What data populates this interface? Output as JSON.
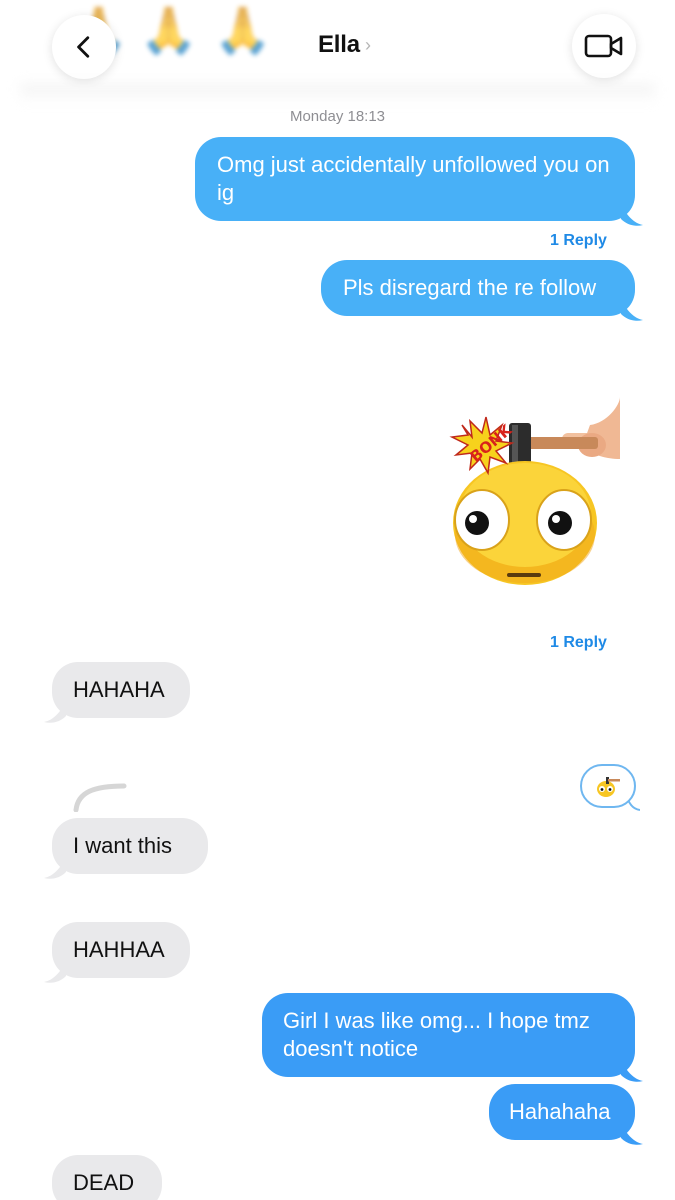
{
  "header": {
    "contact_name": "Ella",
    "name_chevron": "›",
    "blurred_emojis": [
      "🙏",
      "🙏",
      "🙏"
    ]
  },
  "thread": {
    "timestamp": "Monday 18:13",
    "messages": [
      {
        "id": "m1",
        "direction": "outgoing",
        "text": "Omg just accidentally unfollowed you on ig"
      },
      {
        "id": "m1_reply",
        "text": "1 Reply"
      },
      {
        "id": "m2",
        "direction": "outgoing",
        "text": "Pls disregard the re follow"
      },
      {
        "id": "m3",
        "direction": "outgoing",
        "type": "sticker",
        "sticker": "bonk-emoji-sticker"
      },
      {
        "id": "m3_reply",
        "text": "1 Reply"
      },
      {
        "id": "m4",
        "direction": "incoming",
        "text": "HAHAHA"
      },
      {
        "id": "m5",
        "direction": "incoming",
        "text": "I want this"
      },
      {
        "id": "m6",
        "direction": "incoming",
        "text": "HAHHAA"
      },
      {
        "id": "m7",
        "direction": "outgoing",
        "text": "Girl I was like omg... I hope tmz doesn't notice"
      },
      {
        "id": "m8",
        "direction": "outgoing",
        "text": "Hahahaha"
      },
      {
        "id": "m9",
        "direction": "incoming",
        "text": "DEAD"
      }
    ],
    "sticker_text": "BONK"
  },
  "colors": {
    "outgoing_bubble": "#3a9cf6",
    "outgoing_bubble_light": "#48b0f7",
    "incoming_bubble": "#e9e9eb",
    "link": "#1f8ae6"
  },
  "icons": {
    "back": "chevron-left-icon",
    "video": "video-camera-icon"
  }
}
